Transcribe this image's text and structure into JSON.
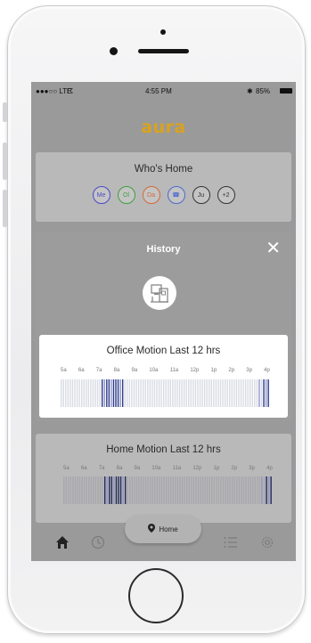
{
  "status": {
    "carrier": "●●●○○ LTE",
    "time": "4:55 PM",
    "battery": "85%"
  },
  "app": {
    "logo": "aura"
  },
  "whos_home": {
    "title": "Who's Home",
    "avatars": [
      "Me",
      "Ol",
      "Da",
      "☎",
      "Ju",
      "+2"
    ],
    "avatar_colors": [
      "#4a4ac8",
      "#3f9f3f",
      "#d26a3a",
      "#4a6ad0",
      "#333333",
      "#333333"
    ]
  },
  "history_modal": {
    "title": "History",
    "close_label": "✕",
    "card_title": "Office Motion Last 12 hrs"
  },
  "home_motion": {
    "title": "Home Motion Last 12 hrs"
  },
  "hours": [
    "5a",
    "6a",
    "7a",
    "8a",
    "9a",
    "10a",
    "11a",
    "12p",
    "1p",
    "2p",
    "3p",
    "4p"
  ],
  "motion_bars": {
    "accent": "#2d3a8a",
    "activity_fraction_by_slot": [
      0,
      0,
      0,
      0,
      0,
      0,
      0,
      0,
      0,
      0,
      0,
      0,
      0,
      0,
      0,
      0,
      0,
      0,
      1,
      0.4,
      1,
      1,
      0.4,
      1,
      1,
      1,
      0.4,
      1,
      0,
      0,
      0,
      0,
      0,
      0,
      0,
      0,
      0,
      0,
      0,
      0,
      0,
      0,
      0,
      0,
      0,
      0,
      0,
      0,
      0,
      0,
      0,
      0,
      0,
      0,
      0,
      0,
      0,
      0,
      0,
      0,
      0,
      0,
      0,
      0,
      0,
      0,
      0,
      0,
      0,
      0,
      0,
      0,
      0,
      0,
      0,
      0,
      0,
      0,
      0,
      0,
      0,
      0,
      0,
      0,
      0,
      0,
      0,
      0.5,
      0,
      1,
      0.4,
      1
    ]
  },
  "tabbar": {
    "home_pill_label": "Home",
    "icons": [
      "home-icon",
      "history-icon",
      "location-pin-icon",
      "list-icon",
      "gear-icon"
    ]
  }
}
